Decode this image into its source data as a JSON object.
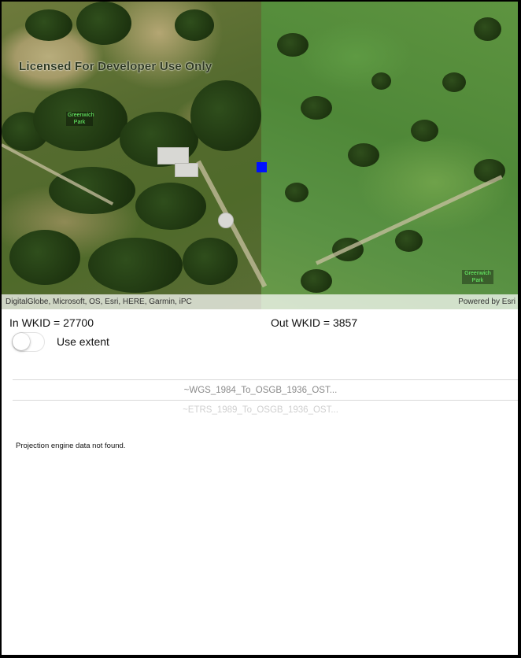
{
  "map": {
    "watermark": "Licensed For Developer Use Only",
    "place_label_left": "Greenwich Park",
    "place_label_right": "Greenwich Park",
    "attribution_left": "DigitalGlobe, Microsoft, OS, Esri, HERE, Garmin, iPC",
    "attribution_right": "Powered by Esri",
    "marker_color": "#0011ff"
  },
  "wkid": {
    "in_label": "In WKID = 27700",
    "out_label": "Out WKID = 3857"
  },
  "extent_toggle": {
    "label": "Use extent",
    "on": false
  },
  "transformations": {
    "selected": "~WGS_1984_To_OSGB_1936_OST...",
    "next": "~ETRS_1989_To_OSGB_1936_OST..."
  },
  "status": {
    "message": "Projection engine data not found."
  }
}
